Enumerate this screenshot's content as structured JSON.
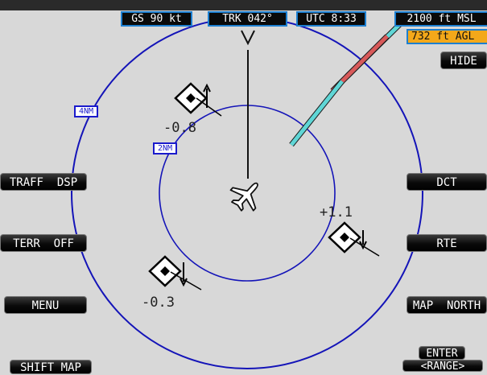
{
  "header": {
    "ground_speed": "GS  90 kt",
    "track": "TRK 042°",
    "utc": "UTC 8:33",
    "altitude_msl": "2100 ft MSL",
    "altitude_agl": "732 ft AGL"
  },
  "range_rings": {
    "outer_label": "4NM",
    "inner_label": "2NM"
  },
  "traffic": [
    {
      "relative_altitude": "-0.8"
    },
    {
      "relative_altitude": "+1.1"
    },
    {
      "relative_altitude": "-0.3"
    }
  ],
  "buttons": {
    "hide": "HIDE",
    "traff_dsp": "TRAFF  DSP",
    "terr_off": "TERR  OFF",
    "menu": "MENU",
    "shift_map": "SHIFT MAP",
    "dct": "DCT",
    "rte": "RTE",
    "map_north": "MAP  NORTH",
    "enter": "ENTER",
    "range": "<RANGE>"
  },
  "icons": [
    "ownship-aircraft-icon",
    "traffic-diamond-icon",
    "heading-caret-icon"
  ],
  "colors": {
    "background": "#d8d8d8",
    "range_ring": "#1414b8",
    "route_red": "#d85a5a",
    "route_cyan": "#5fd6d6",
    "agl_bg": "#f3a81a"
  }
}
